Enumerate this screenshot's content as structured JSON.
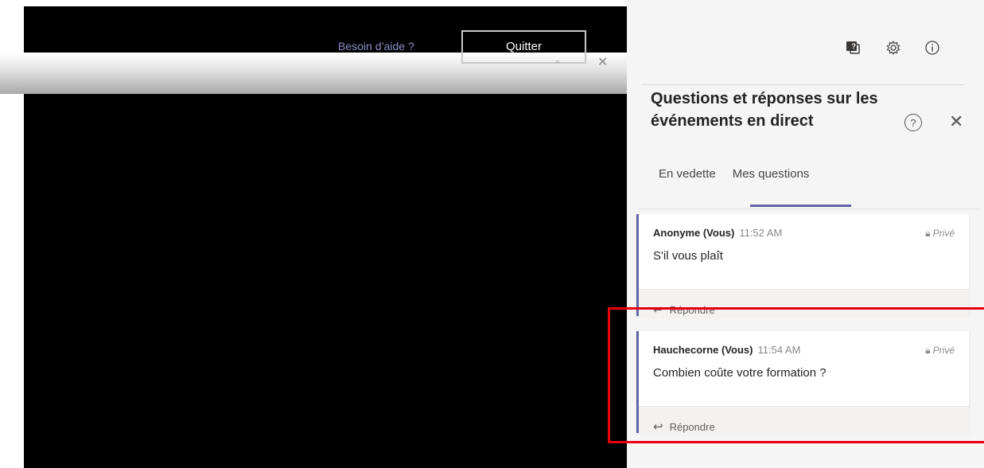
{
  "top_bar": {
    "help_link": "Besoin d’aide ?",
    "quit_button": "Quitter"
  },
  "panel": {
    "title": "Questions et réponses sur les événements en direct",
    "tabs": [
      {
        "label": "En vedette",
        "active": false
      },
      {
        "label": "Mes questions",
        "active": true
      }
    ],
    "questions": [
      {
        "author": "Anonyme (Vous)",
        "time": "11:52 AM",
        "visibility": "Privé",
        "text": "S'il vous plaît",
        "reply_label": "Répondre"
      },
      {
        "author": "Hauchecorne (Vous)",
        "time": "11:54 AM",
        "visibility": "Privé",
        "text": "Combien coûte votre formation ?",
        "reply_label": "Répondre"
      }
    ]
  },
  "colors": {
    "accent": "#6264a7",
    "highlight": "#e8000b"
  }
}
